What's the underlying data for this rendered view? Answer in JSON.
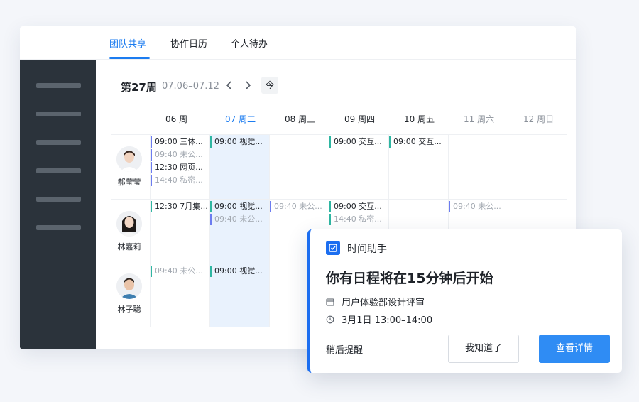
{
  "tabs": [
    {
      "label": "团队共享",
      "active": true
    },
    {
      "label": "协作日历",
      "active": false
    },
    {
      "label": "个人待办",
      "active": false
    }
  ],
  "sidebar": {
    "item_count": 6
  },
  "week": {
    "title": "第27周",
    "range": "07.06–07.12",
    "today_button": "今"
  },
  "days": [
    {
      "date": "06",
      "weekday": "周一"
    },
    {
      "date": "07",
      "weekday": "周二",
      "today": true
    },
    {
      "date": "08",
      "weekday": "周三"
    },
    {
      "date": "09",
      "weekday": "周四"
    },
    {
      "date": "10",
      "weekday": "周五"
    },
    {
      "date": "11",
      "weekday": "周六",
      "weekend": true
    },
    {
      "date": "12",
      "weekday": "周日",
      "weekend": true
    }
  ],
  "people": [
    {
      "name": "郝莹莹"
    },
    {
      "name": "林嘉莉"
    },
    {
      "name": "林子聪"
    }
  ],
  "events": {
    "p0_mon": [
      "09:00 三体...",
      "09:40 未公...",
      "12:30 网页...",
      "14:40 私密..."
    ],
    "p0_tue": [
      "09:00 视觉..."
    ],
    "p0_thu": [
      "09:00 交互..."
    ],
    "p0_fri": [
      "09:00 交互..."
    ],
    "p1_mon": [
      "12:30 7月集..."
    ],
    "p1_tue": [
      "09:00 视觉...",
      "09:40 未公..."
    ],
    "p1_wed": [
      "09:40 未公..."
    ],
    "p1_thu": [
      "09:00 交互...",
      "14:40 私密..."
    ],
    "p1_sat": [
      "09:40 未公..."
    ],
    "p2_mon": [
      "09:40 未公..."
    ],
    "p2_tue": [
      "09:00 视觉..."
    ]
  },
  "popup": {
    "app_name": "时间助手",
    "title": "你有日程将在15分钟后开始",
    "event_name": "用户体验部设计评审",
    "event_time": "3月1日 13:00–14:00",
    "snooze_label": "稍后提醒",
    "ack_label": "我知道了",
    "detail_label": "查看详情"
  },
  "colors": {
    "accent": "#1c7cf0",
    "sidebar_bg": "#2b333b",
    "today_column": "#e9f2fd",
    "event_teal": "#2fb6a2",
    "event_purple": "#6c7cf0",
    "primary_button": "#2f8cf4"
  },
  "icons": {
    "popup_icon": "check-calendar-icon",
    "event_icon": "calendar-icon",
    "time_icon": "clock-icon",
    "prev": "chevron-left-icon",
    "next": "chevron-right-icon"
  }
}
